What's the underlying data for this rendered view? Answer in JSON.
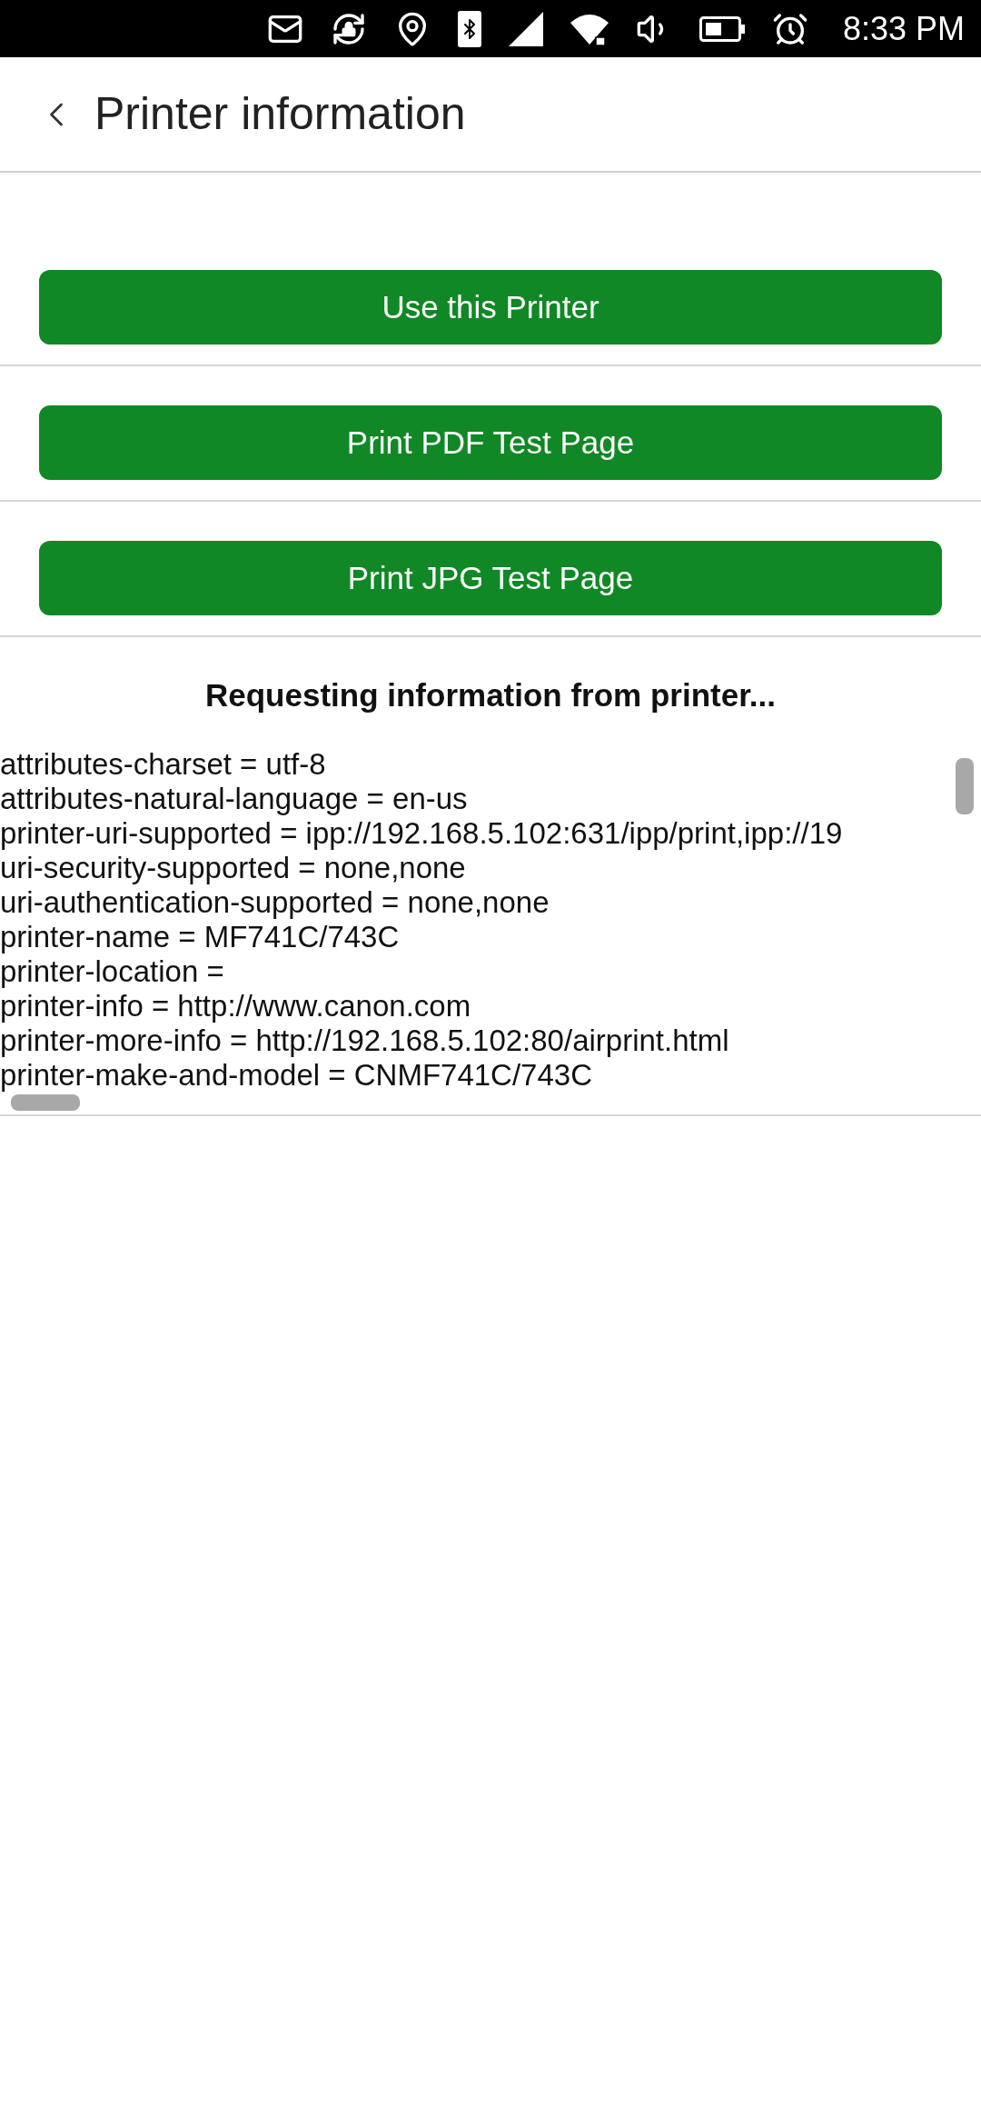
{
  "status_bar": {
    "time": "8:33 PM"
  },
  "header": {
    "title": "Printer information"
  },
  "buttons": [
    {
      "label": "Use this Printer"
    },
    {
      "label": "Print PDF Test Page"
    },
    {
      "label": "Print JPG Test Page"
    }
  ],
  "status_message": "Requesting information from printer...",
  "info_lines": [
    "attributes-charset = utf-8",
    "attributes-natural-language = en-us",
    "printer-uri-supported = ipp://192.168.5.102:631/ipp/print,ipp://19",
    "uri-security-supported = none,none",
    "uri-authentication-supported = none,none",
    "printer-name = MF741C/743C",
    "printer-location =",
    "printer-info = http://www.canon.com",
    "printer-more-info = http://192.168.5.102:80/airprint.html",
    "printer-make-and-model = CNMF741C/743C"
  ]
}
